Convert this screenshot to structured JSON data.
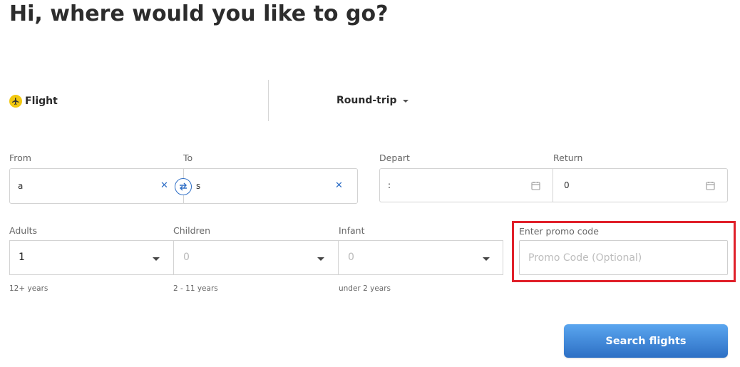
{
  "heading": "Hi, where would you like to go?",
  "trip_type": {
    "icon": "airplane-icon",
    "label": "Flight"
  },
  "trip_mode": {
    "label": "Round-trip"
  },
  "route": {
    "from": {
      "label": "From",
      "value": "a"
    },
    "to": {
      "label": "To",
      "value": "s"
    },
    "swap_icon": "swap-arrows-icon"
  },
  "dates": {
    "depart": {
      "label": "Depart",
      "value": ":"
    },
    "return": {
      "label": "Return",
      "value": "0"
    }
  },
  "passengers": {
    "adults": {
      "label": "Adults",
      "value": "1",
      "hint": "12+ years"
    },
    "children": {
      "label": "Children",
      "value": "0",
      "hint": "2 - 11 years"
    },
    "infant": {
      "label": "Infant",
      "value": "0",
      "hint": "under 2 years"
    }
  },
  "promo": {
    "label": "Enter promo code",
    "placeholder": "Promo Code (Optional)"
  },
  "search_button": {
    "label": "Search flights"
  },
  "colors": {
    "accent": "#2e6ec6",
    "highlight": "#e0202a",
    "flight_icon_bg": "#f2c80f"
  }
}
